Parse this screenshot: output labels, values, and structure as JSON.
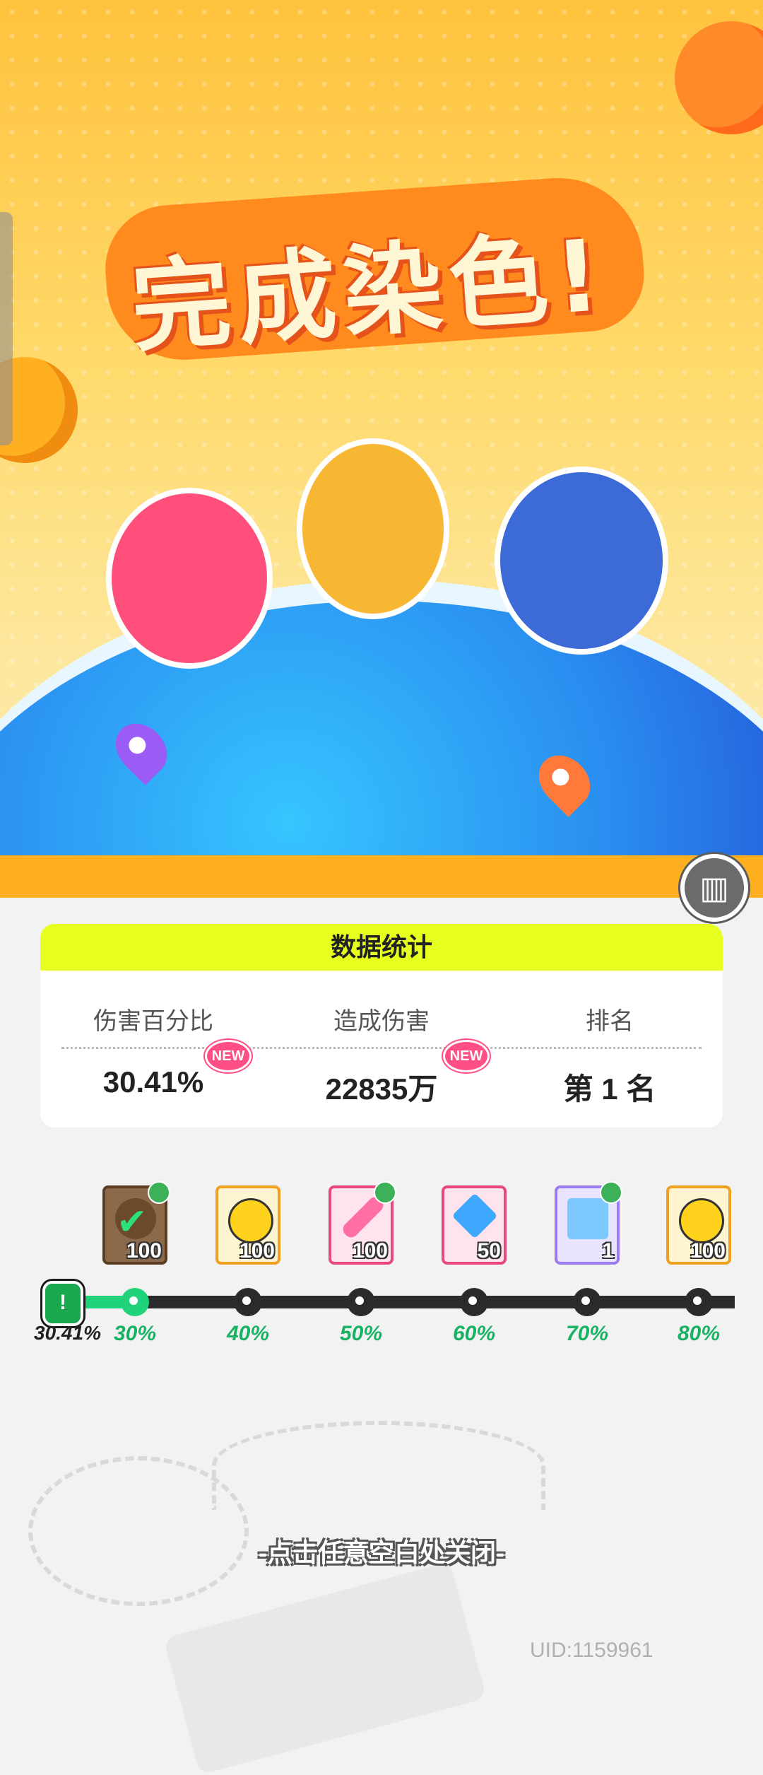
{
  "banner": {
    "title": "完成染色!"
  },
  "stats_panel": {
    "header": "数据统计",
    "columns": [
      {
        "label": "伤害百分比",
        "value": "30.41%",
        "new_badge": "NEW"
      },
      {
        "label": "造成伤害",
        "value": "22835万",
        "new_badge": "NEW"
      },
      {
        "label": "排名",
        "value": "第 1 名"
      }
    ]
  },
  "rewards": [
    {
      "icon": "pen-icon",
      "quantity": "100",
      "claimed": true
    },
    {
      "icon": "lion-coin-icon",
      "quantity": "100",
      "claimed": false
    },
    {
      "icon": "crayon-icon",
      "quantity": "100",
      "claimed": false
    },
    {
      "icon": "diamond-icon",
      "quantity": "50",
      "claimed": false
    },
    {
      "icon": "milk-carton-icon",
      "quantity": "1",
      "claimed": false
    },
    {
      "icon": "lion-coin-icon",
      "quantity": "100",
      "claimed": false
    }
  ],
  "progress": {
    "current_marker": "!",
    "current": "30.41%",
    "current_value": 30.41,
    "milestones": [
      "30%",
      "40%",
      "50%",
      "60%",
      "70%",
      "80%"
    ]
  },
  "footer": {
    "close_hint": "-点击任意空白处关闭-",
    "uid": "UID:1159961"
  },
  "colors": {
    "header_lime": "#e6ff1e",
    "progress_green": "#20d37a",
    "badge_pink": "#ff4f84",
    "title_orange": "#ff8a1e"
  }
}
